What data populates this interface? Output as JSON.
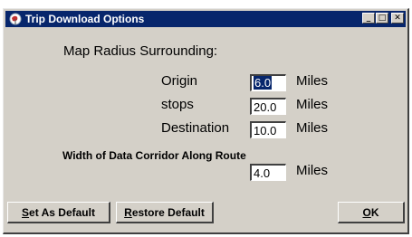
{
  "window": {
    "title": "Trip Download Options",
    "minimize_glyph": "_",
    "maximize_glyph": "□",
    "close_glyph": "✕"
  },
  "map_radius": {
    "heading": "Map Radius Surrounding:",
    "rows": [
      {
        "label": "Origin",
        "value": "6.0",
        "unit": "Miles"
      },
      {
        "label": "stops",
        "value": "20.0",
        "unit": "Miles"
      },
      {
        "label": "Destination",
        "value": "10.0",
        "unit": "Miles"
      }
    ]
  },
  "corridor": {
    "heading": "Width of Data Corridor Along Route",
    "value": "4.0",
    "unit": "Miles"
  },
  "buttons": {
    "set_default": {
      "accel": "S",
      "rest": "et As Default"
    },
    "restore_default": {
      "accel": "R",
      "rest": "estore Default"
    },
    "ok": {
      "accel": "O",
      "rest": "K"
    }
  },
  "colors": {
    "titlebar": "#07266c",
    "face": "#d4d0c8"
  }
}
